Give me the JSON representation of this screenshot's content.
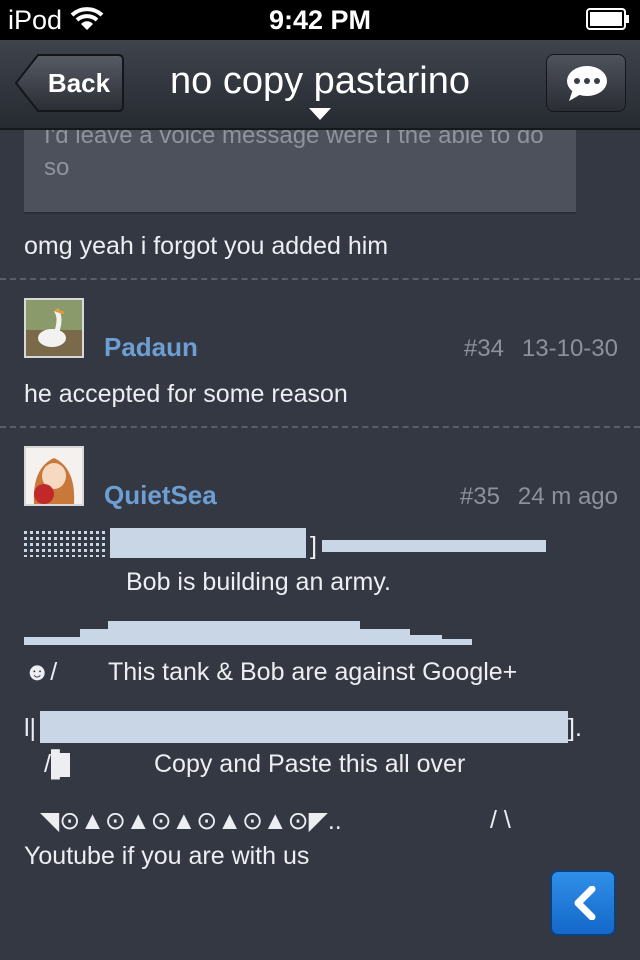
{
  "status_bar": {
    "carrier": "iPod",
    "time": "9:42 PM"
  },
  "nav": {
    "back_label": "Back",
    "title": "no copy pastarino"
  },
  "thread": {
    "quoted_text": "I'd leave a voice message were I the able to do so",
    "reply_text": "omg yeah i forgot you added him",
    "posts": [
      {
        "username": "Padaun",
        "number": "#34",
        "time": "13-10-30",
        "body": "he accepted for some reason"
      },
      {
        "username": "QuietSea",
        "number": "#35",
        "time": "24 m ago",
        "body": {
          "bracket_close": "]",
          "line_army": "Bob is building an army.",
          "smiley_arm": "☻/",
          "line_against": "This tank & Bob are against Google+",
          "track_left": "l|",
          "track_right": "].",
          "leg": "/▌",
          "line_copy": "Copy and Paste this all over",
          "wheels": "◥⊙▲⊙▲⊙▲⊙▲⊙▲⊙◤..",
          "feet": "/ \\",
          "line_youtube": "Youtube if you are with us"
        }
      }
    ]
  },
  "colors": {
    "background": "#343843",
    "username": "#6e9fd4",
    "art_block": "#c9d6e6",
    "accent_button": "#1f7ad9"
  },
  "icons": {
    "status": [
      "wifi-icon",
      "battery-icon"
    ],
    "nav": [
      "back-arrow-icon",
      "chevron-down-icon",
      "chat-bubble-icon"
    ],
    "fab": "chevron-left-icon"
  }
}
